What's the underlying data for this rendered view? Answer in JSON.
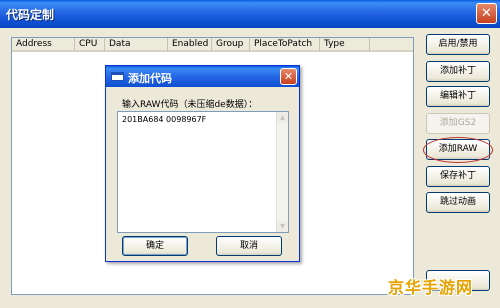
{
  "window": {
    "title": "代码定制",
    "close_glyph": "✕"
  },
  "list": {
    "columns": [
      "Address",
      "CPU",
      "Data",
      "Enabled",
      "Group",
      "PlaceToPatch",
      "Type"
    ]
  },
  "side_buttons": {
    "enable_disable": "启用/禁用",
    "add_patch": "添加补丁",
    "edit_patch": "编辑补丁",
    "add_gs2": "添加GS2",
    "add_raw": "添加RAW",
    "save_patch": "保存补丁",
    "skip_animation": "跳过动画"
  },
  "dialog": {
    "title": "添加代码",
    "close_glyph": "✕",
    "prompt": "输入RAW代码（未压缩de数据）：",
    "raw_value": "201BA684 0098967F",
    "ok_label": "确定",
    "cancel_label": "取消"
  },
  "watermark": "京华手游网",
  "colors": {
    "xp_blue": "#0a5cdc",
    "window_bg": "#ece9d8",
    "highlight_oval": "#c03030",
    "watermark": "#e8a200"
  }
}
